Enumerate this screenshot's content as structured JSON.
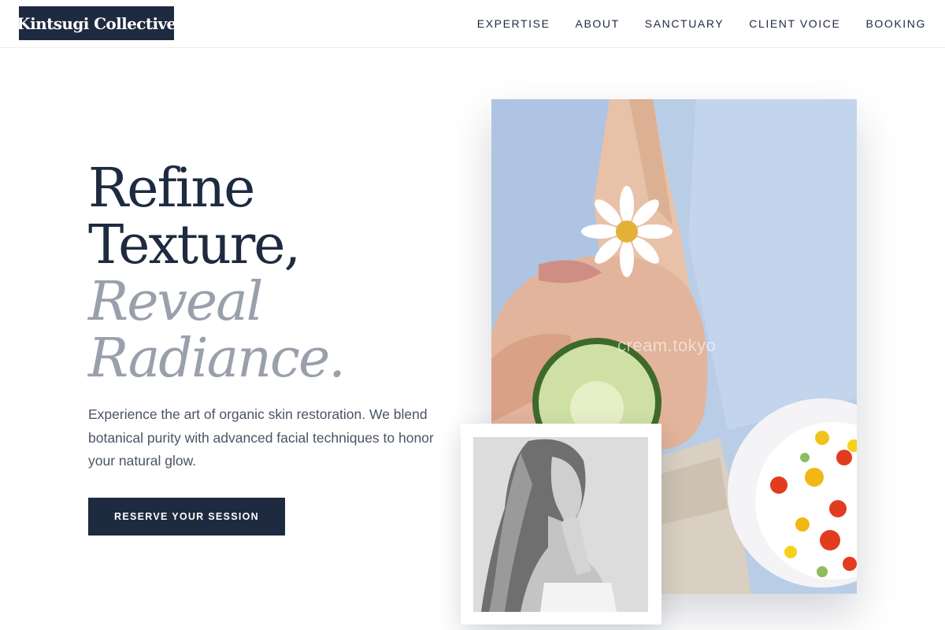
{
  "brand": {
    "name": "Kintsugi Collective"
  },
  "nav": {
    "items": [
      "EXPERTISE",
      "ABOUT",
      "SANCTUARY",
      "CLIENT VOICE",
      "BOOKING"
    ]
  },
  "hero": {
    "line1": "Refine",
    "line2": "Texture,",
    "line3": "Reveal",
    "line4": "Radiance.",
    "description": "Experience the art of organic skin restoration. We blend botanical purity with advanced facial techniques to honor your natural glow.",
    "cta_label": "RESERVE YOUR SESSION",
    "image_watermark": "cream.tokyo"
  },
  "colors": {
    "navy": "#1e2a3f",
    "muted_gray": "#9aa0ab",
    "body_text": "#4a5466"
  }
}
